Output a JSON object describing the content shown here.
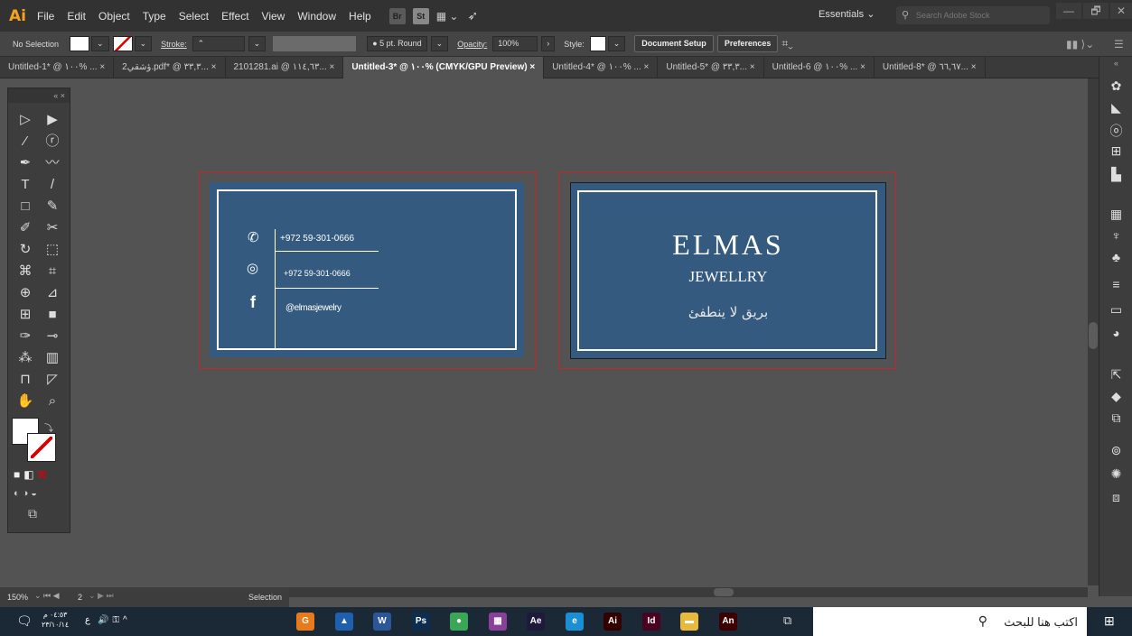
{
  "app": {
    "logo": "Ai"
  },
  "menu": [
    "File",
    "Edit",
    "Object",
    "Type",
    "Select",
    "Effect",
    "View",
    "Window",
    "Help"
  ],
  "menu_right": {
    "bridge": "Br",
    "stock_btn": "St",
    "workspace": "Essentials",
    "search_placeholder": "Search Adobe Stock"
  },
  "window_controls": {
    "minimize": "—",
    "restore": "🗗",
    "close": "✕"
  },
  "control_bar": {
    "selection": "No Selection",
    "stroke_label": "Stroke:",
    "brush": "5 pt. Round",
    "opacity_label": "Opacity:",
    "opacity_value": "100%",
    "style_label": "Style:",
    "document_setup": "Document Setup",
    "preferences": "Preferences"
  },
  "tabs": [
    {
      "label": "Untitled-1* @ ١٠٠% ...",
      "active": false
    },
    {
      "label": "ؤشقي2.pdf* @ ٣٣,٣... ",
      "active": false
    },
    {
      "label": "2101281.ai @ ١١٤,٦٣... ",
      "active": false
    },
    {
      "label": "Untitled-3* @ ١٠٠% (CMYK/GPU Preview)",
      "active": true
    },
    {
      "label": "Untitled-4* @ ١٠٠% ...",
      "active": false
    },
    {
      "label": "Untitled-5* @ ٣٣,٣... ",
      "active": false
    },
    {
      "label": "Untitled-6 @ ١٠٠% ...",
      "active": false
    },
    {
      "label": "Untitled-8* @ ٦٦,٦٧... ",
      "active": false
    }
  ],
  "tab_close": "×",
  "card_back": {
    "phone": "+972 59-301-0666",
    "whatsapp": "+972 59-301-0666",
    "facebook": "@elmasjewelry",
    "facebook_icon": "f"
  },
  "card_front": {
    "brand": "ELMAS",
    "subtitle": "JEWELLRY",
    "tagline": "بريق لا ينطفئ"
  },
  "colors": {
    "card": "#345b7f",
    "frame": "#c1272d",
    "canvas": "#535353"
  },
  "status": {
    "zoom": "150%",
    "page": "2",
    "tool": "Selection"
  },
  "taskbar": {
    "time": "٠٤:٥٣ م",
    "date": "٢٣/١٠/١٤",
    "lang": "ع",
    "search": "اكتب هنا للبحث"
  },
  "taskbar_apps": [
    {
      "name": "pdf-app-icon",
      "label": "G",
      "color": "#e87a1b"
    },
    {
      "name": "photos-icon",
      "label": "▲",
      "color": "#1f5fb0"
    },
    {
      "name": "word-icon",
      "label": "W",
      "color": "#2b579a"
    },
    {
      "name": "photoshop-icon",
      "label": "Ps",
      "color": "#0d2d4f"
    },
    {
      "name": "chrome-icon",
      "label": "●",
      "color": "#3aa757"
    },
    {
      "name": "winrar-icon",
      "label": "▦",
      "color": "#8a3f9b"
    },
    {
      "name": "after-effects-icon",
      "label": "Ae",
      "color": "#1d1a3b"
    },
    {
      "name": "edge-icon",
      "label": "e",
      "color": "#1a8fd6"
    },
    {
      "name": "illustrator-icon",
      "label": "Ai",
      "color": "#330000"
    },
    {
      "name": "indesign-icon",
      "label": "Id",
      "color": "#49021f"
    },
    {
      "name": "file-explorer-icon",
      "label": "▬",
      "color": "#e8b93b"
    },
    {
      "name": "animate-icon",
      "label": "An",
      "color": "#3d0000"
    }
  ]
}
